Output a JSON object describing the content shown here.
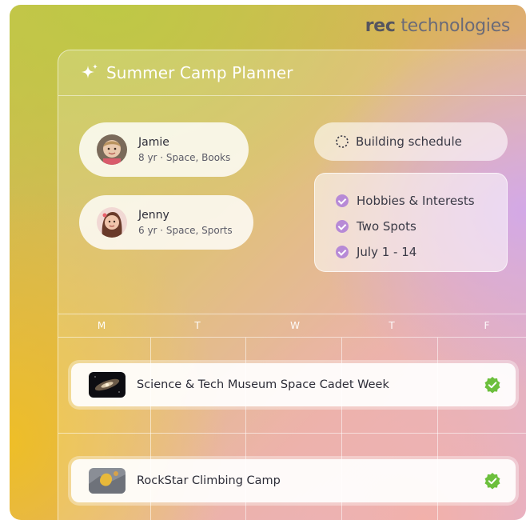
{
  "brand": {
    "bold": "rec",
    "rest": " technologies"
  },
  "planner": {
    "title": "Summer Camp Planner",
    "children": [
      {
        "name": "Jamie",
        "info": "8 yr · Space, Books"
      },
      {
        "name": "Jenny",
        "info": "6 yr · Space, Sports"
      }
    ],
    "status": "Building schedule",
    "criteria": [
      "Hobbies & Interests",
      "Two Spots",
      "July 1 - 14"
    ],
    "days": [
      "M",
      "T",
      "W",
      "T",
      "F"
    ],
    "events": [
      {
        "title": "Science & Tech Museum Space Cadet Week",
        "status_icon": "verified-check-icon"
      },
      {
        "title": "RockStar Climbing Camp",
        "status_icon": "verified-check-icon"
      }
    ]
  },
  "colors": {
    "accent_purple": "#b78ad6",
    "check_green": "#6cbf3c"
  }
}
